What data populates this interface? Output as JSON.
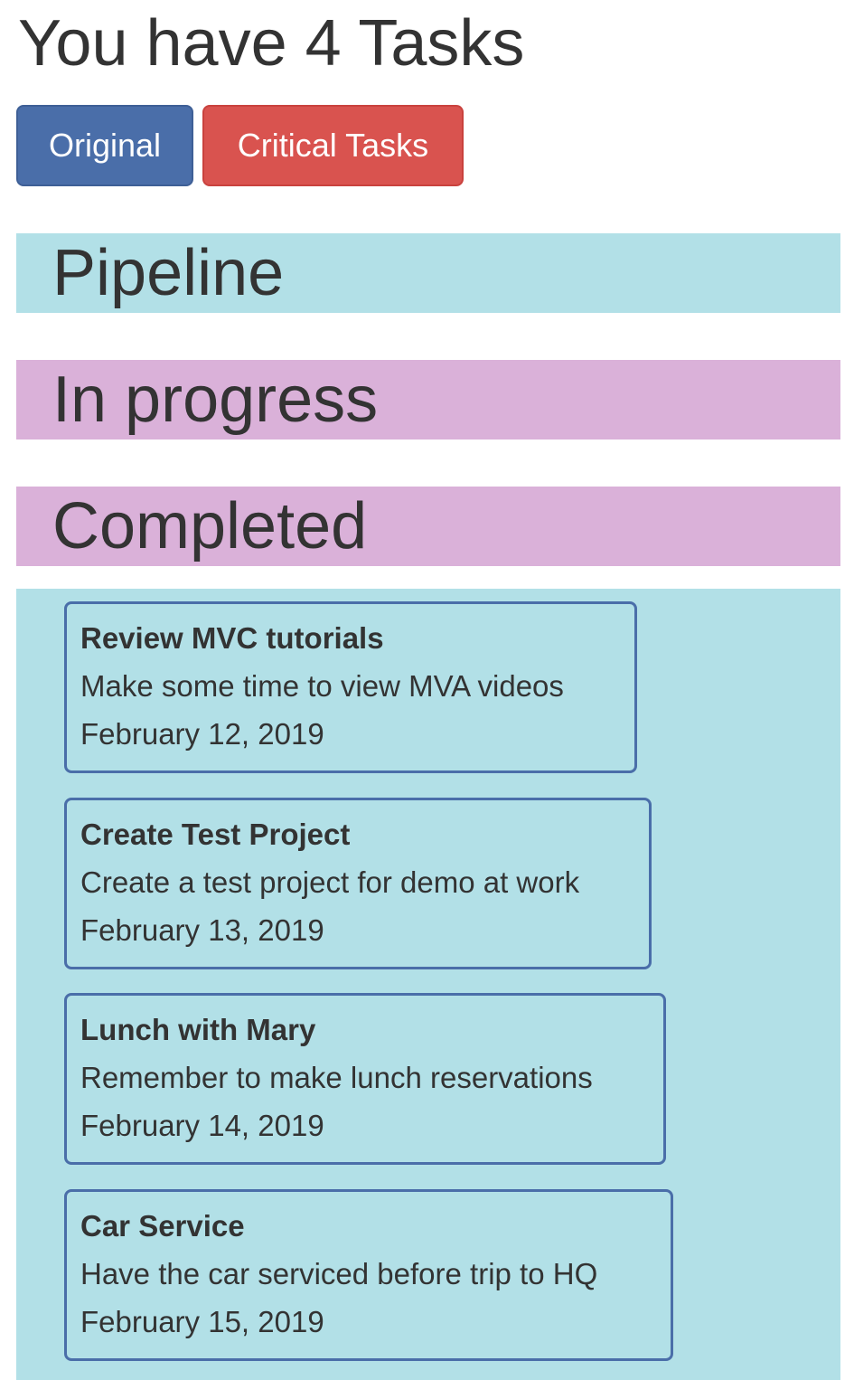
{
  "header": {
    "title": "You have 4 Tasks"
  },
  "buttons": {
    "original_label": "Original",
    "critical_label": "Critical Tasks"
  },
  "sections": {
    "pipeline": "Pipeline",
    "in_progress": "In progress",
    "completed": "Completed"
  },
  "tasks": [
    {
      "title": "Review MVC tutorials",
      "description": "Make some time to view MVA videos",
      "date": "February 12, 2019"
    },
    {
      "title": "Create Test Project",
      "description": "Create a test project for demo at work",
      "date": "February 13, 2019"
    },
    {
      "title": "Lunch with Mary",
      "description": "Remember to make lunch reservations",
      "date": "February 14, 2019"
    },
    {
      "title": "Car Service",
      "description": "Have the car serviced before trip to HQ",
      "date": "February 15, 2019"
    }
  ],
  "colors": {
    "original_button": "#4a6ea9",
    "critical_button": "#d9534f",
    "pipeline_bar": "#b2e0e7",
    "in_progress_bar": "#dab1d9",
    "completed_bar": "#dab1d9",
    "task_area": "#b2e0e7",
    "card_border": "#4a6ea9"
  }
}
